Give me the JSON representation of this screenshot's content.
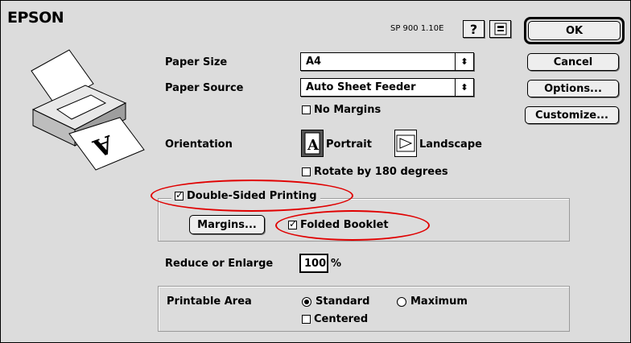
{
  "header": {
    "logo": "EPSON",
    "version": "SP 900 1.10E",
    "help_glyph": "?",
    "extra_icon": "printer-tool-icon"
  },
  "buttons": {
    "ok": "OK",
    "cancel": "Cancel",
    "options": "Options...",
    "customize": "Customize..."
  },
  "paper_size": {
    "label": "Paper Size",
    "value": "A4"
  },
  "paper_source": {
    "label": "Paper Source",
    "value": "Auto Sheet Feeder"
  },
  "no_margins": {
    "label": "No Margins",
    "checked": false
  },
  "orientation": {
    "label": "Orientation",
    "portrait": "Portrait",
    "landscape": "Landscape",
    "selected": "portrait"
  },
  "rotate": {
    "label": "Rotate by 180 degrees",
    "checked": false
  },
  "double_sided": {
    "label": "Double-Sided Printing",
    "checked": true,
    "margins_button": "Margins...",
    "folded_booklet": "Folded Booklet",
    "folded_checked": true
  },
  "reduce": {
    "label": "Reduce or Enlarge",
    "value": "100",
    "unit": "%"
  },
  "printable_area": {
    "label": "Printable Area",
    "standard": "Standard",
    "maximum": "Maximum",
    "selected": "standard",
    "centered": "Centered",
    "centered_checked": false
  },
  "highlight_color": "#e00000"
}
